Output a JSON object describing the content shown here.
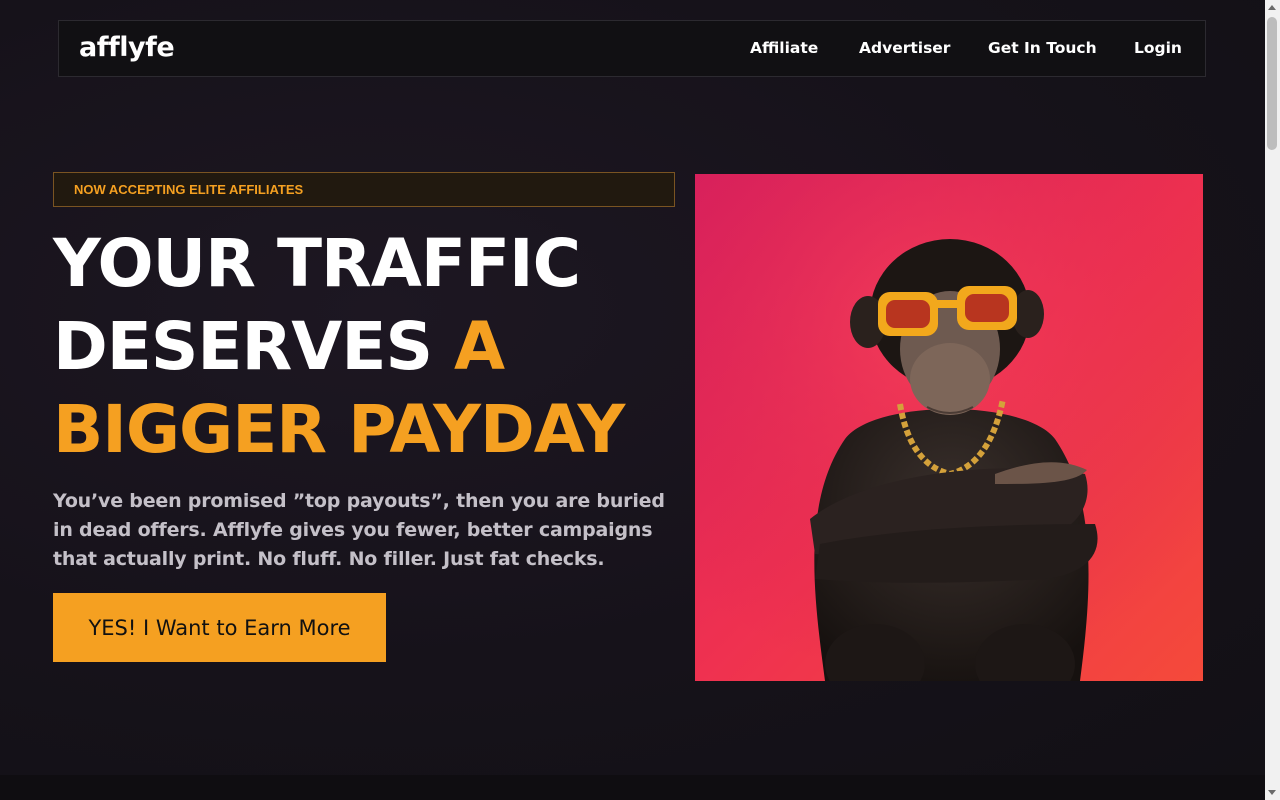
{
  "nav": {
    "logo": "afflyfe",
    "items": [
      "Affiliate",
      "Advertiser",
      "Get In Touch",
      "Login"
    ]
  },
  "hero": {
    "badge": "NOW ACCEPTING ELITE AFFILIATES",
    "headline": {
      "line1": "YOUR TRAFFIC",
      "line2_white": "DESERVES",
      "line2_orange": "A",
      "line3": "BIGGER PAYDAY"
    },
    "subtext": "You’ve been promised ”top payouts”, then you are buried in dead offers. Afflyfe gives you fewer, better campaigns that actually print. No fluff. No filler. Just fat checks.",
    "cta": "YES! I Want to Earn More",
    "image": "chimpanzee-with-sunglasses-and-gold-chain"
  },
  "colors": {
    "accent": "#f5a021",
    "background": "#161219",
    "navbar": "#111013"
  }
}
